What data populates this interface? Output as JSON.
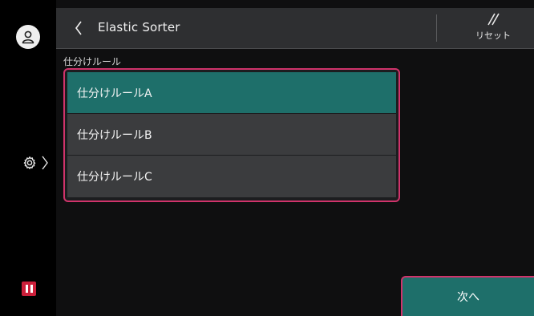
{
  "header": {
    "title": "Elastic Sorter",
    "reset_label": "リセット"
  },
  "main": {
    "section_label": "仕分けルール",
    "rules": [
      {
        "label": "仕分けルールA",
        "selected": true
      },
      {
        "label": "仕分けルールB",
        "selected": false
      },
      {
        "label": "仕分けルールC",
        "selected": false
      }
    ],
    "next_label": "次へ"
  },
  "sidebar": {
    "icons": [
      "user-icon",
      "gear-icon",
      "chevron-right-icon",
      "pause-icon"
    ]
  },
  "colors": {
    "accent_teal": "#1e6f6a",
    "focus_pink": "#d0336b",
    "pause_red": "#cc1f3a"
  }
}
